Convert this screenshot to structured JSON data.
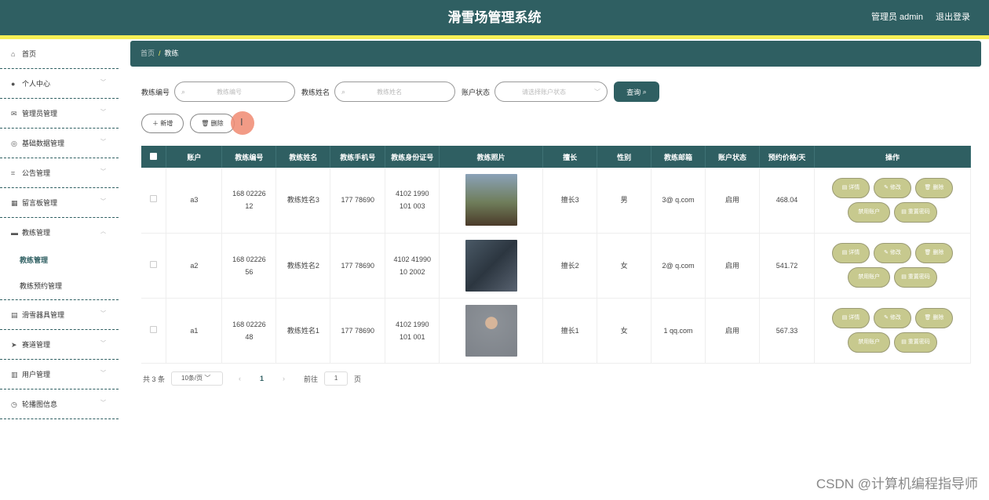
{
  "app": {
    "title": "滑雪场管理系统",
    "user_label": "管理员 admin",
    "logout": "退出登录"
  },
  "sidebar": {
    "items": [
      {
        "label": "首页",
        "icon": "home-icon"
      },
      {
        "label": "个人中心",
        "icon": "user-icon"
      },
      {
        "label": "管理员管理",
        "icon": "mail-icon"
      },
      {
        "label": "基础数据管理",
        "icon": "compass-icon"
      },
      {
        "label": "公告管理",
        "icon": "crop-icon"
      },
      {
        "label": "留言板管理",
        "icon": "bank-icon"
      },
      {
        "label": "教练管理",
        "icon": "ticket-icon"
      },
      {
        "label": "滑雪器具管理",
        "icon": "printer-icon"
      },
      {
        "label": "赛道管理",
        "icon": "send-icon"
      },
      {
        "label": "用户管理",
        "icon": "doc-icon"
      },
      {
        "label": "轮播图信息",
        "icon": "clock-icon"
      }
    ],
    "sub": [
      "教练管理",
      "教练预约管理"
    ]
  },
  "breadcrumb": {
    "home": "首页",
    "current": "教练"
  },
  "search": {
    "label1": "教练编号",
    "ph1": "教练编号",
    "label2": "教练姓名",
    "ph2": "教练姓名",
    "label3": "账户状态",
    "ph3": "请选择账户状态",
    "query": "查询"
  },
  "actions": {
    "add": "新增",
    "delete": "删除"
  },
  "table": {
    "headers": [
      "账户",
      "教练编号",
      "教练姓名",
      "教练手机号",
      "教练身份证号",
      "教练照片",
      "擅长",
      "性别",
      "教练邮箱",
      "账户状态",
      "预约价格/天",
      "操作"
    ],
    "rows": [
      {
        "account": "a3",
        "id1": "168 02226",
        "id2": "12",
        "name": "教练姓名3",
        "phone1": "177 78690",
        "phone2": "",
        "idcard1": "4102 1990",
        "idcard2": "101 003",
        "skill": "擅长3",
        "gender": "男",
        "email": "3@ q.com",
        "status": "启用",
        "price": "468.04",
        "photo_bg": "#6f7d5a"
      },
      {
        "account": "a2",
        "id1": "168 02226",
        "id2": "56",
        "name": "教练姓名2",
        "phone1": "177 78690",
        "phone2": "",
        "idcard1": "4102 41990",
        "idcard2": "10 2002",
        "skill": "擅长2",
        "gender": "女",
        "email": "2@ q.com",
        "status": "启用",
        "price": "541.72",
        "photo_bg": "#3d4a55"
      },
      {
        "account": "a1",
        "id1": "168 02226",
        "id2": "48",
        "name": "教练姓名1",
        "phone1": "177 78690",
        "phone2": "",
        "idcard1": "4102 1990",
        "idcard2": "101 001",
        "skill": "擅长1",
        "gender": "女",
        "email": "1 qq.com",
        "status": "启用",
        "price": "567.33",
        "photo_bg": "#7d8289"
      }
    ],
    "ops": {
      "detail": "详情",
      "edit": "修改",
      "delete": "删除",
      "disable": "禁用账户",
      "reset": "重置密码"
    }
  },
  "pager": {
    "total": "共 3 条",
    "size": "10条/页",
    "current": "1",
    "goto": "前往",
    "page_input": "1",
    "page_unit": "页"
  },
  "watermark": "CSDN @计算机编程指导师"
}
